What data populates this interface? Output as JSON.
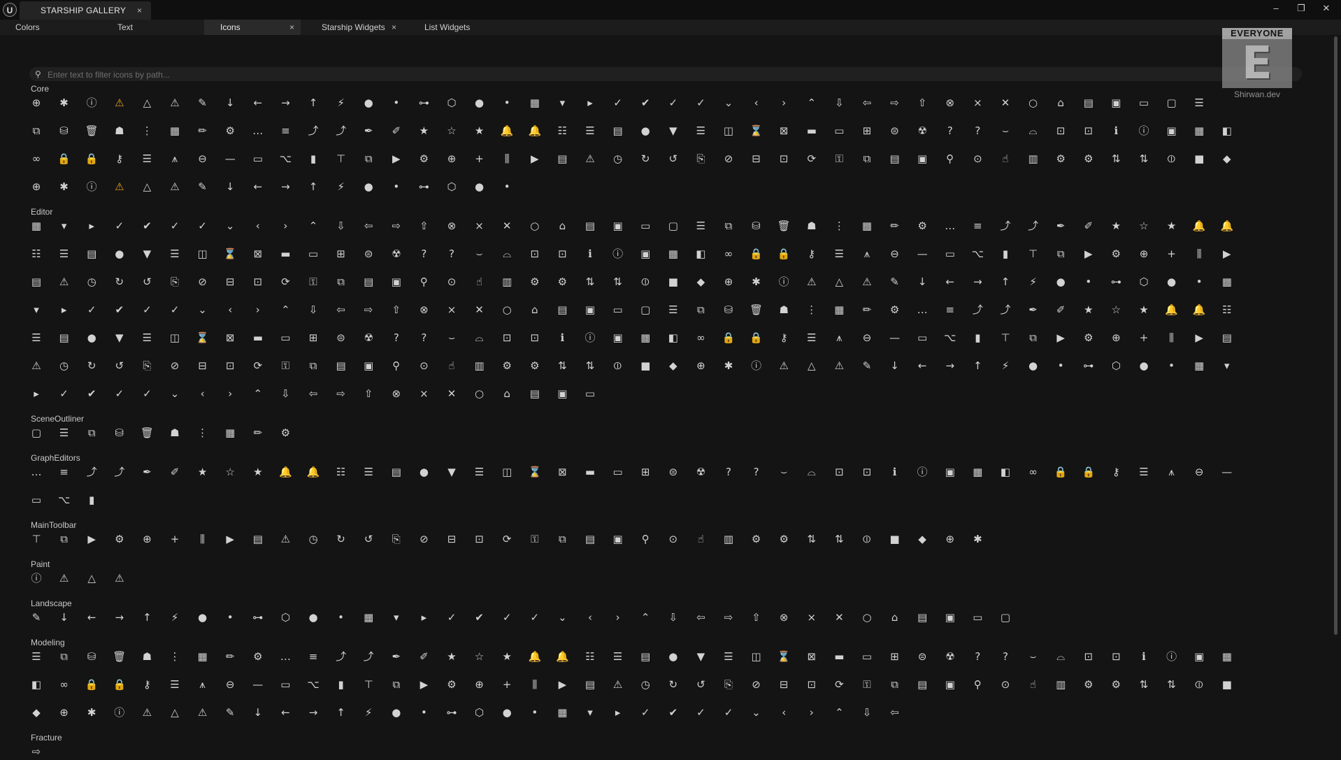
{
  "titlebar": {
    "tab_label": "STARSHIP GALLERY",
    "close_glyph": "×",
    "logo": "U",
    "window_buttons": [
      "–",
      "❐",
      "✕"
    ]
  },
  "tabs": [
    {
      "label": "Colors",
      "closable": false
    },
    {
      "label": "Text",
      "closable": false
    },
    {
      "label": "Icons",
      "closable": true
    },
    {
      "label": "Starship Widgets",
      "closable": true
    },
    {
      "label": "List Widgets",
      "closable": false
    }
  ],
  "search": {
    "placeholder": "Enter text to filter icons by path...",
    "value": ""
  },
  "badge": {
    "rating": "EVERYONE",
    "letter": "E",
    "site": "Shirwan.dev"
  },
  "sections": [
    {
      "name": "Core",
      "rows": [
        43,
        44,
        44,
        18
      ]
    },
    {
      "name": "Editor",
      "rows": [
        44,
        44,
        44,
        44,
        44,
        44,
        21
      ]
    },
    {
      "name": "SceneOutliner",
      "rows": [
        10
      ]
    },
    {
      "name": "GraphEditors",
      "rows": [
        44,
        3
      ]
    },
    {
      "name": "MainToolbar",
      "rows": [
        35
      ]
    },
    {
      "name": "Paint",
      "rows": [
        4
      ]
    },
    {
      "name": "Landscape",
      "rows": [
        36
      ]
    },
    {
      "name": "Modeling",
      "rows": [
        44,
        44,
        32
      ]
    },
    {
      "name": "Fracture",
      "rows": [
        1
      ]
    }
  ],
  "icon_glyphs": [
    "⊕",
    "✱",
    "ⓘ",
    "⚠",
    "△",
    "⚠",
    "✎",
    "↓",
    "←",
    "→",
    "↑",
    "⚡",
    "●",
    "•",
    "⊶",
    "⬡",
    "●",
    "•",
    "▦",
    "▾",
    "▸",
    "✓",
    "✔",
    "✓",
    "✓",
    "⌄",
    "‹",
    "›",
    "⌃",
    "⇩",
    "⇦",
    "⇨",
    "⇧",
    "⊗",
    "×",
    "✕",
    "○",
    "⌂",
    "▤",
    "▣",
    "▭",
    "▢",
    "☰",
    "⧉",
    "⛁",
    "🗑",
    "☗",
    "⋮",
    "▦",
    "✏",
    "⚙",
    "…",
    "≡",
    "⤴",
    "⤴",
    "✒",
    "✐",
    "★",
    "☆",
    "★",
    "🔔",
    "🔔",
    "☷",
    "☰",
    "▤",
    "●",
    "▼",
    "☰",
    "◫",
    "⌛",
    "⊠",
    "▬",
    "▭",
    "⊞",
    "⊜",
    "☢",
    "?",
    "?",
    "⌣",
    "⌓",
    "⊡",
    "⊡",
    "ℹ",
    "ⓘ",
    "▣",
    "▦",
    "◧",
    "∞",
    "🔒",
    "🔒",
    "⚷",
    "☰",
    "⩚",
    "⊖",
    "—",
    "▭",
    "⌥",
    "▮",
    "⊤",
    "⧉",
    "▶",
    "⚙",
    "⊕",
    "+",
    "⫼",
    "▶",
    "▤",
    "⚠",
    "◷",
    "↻",
    "↺",
    "⎘",
    "⊘",
    "⊟",
    "⊡",
    "⟳",
    "⚿",
    "⧉",
    "▤",
    "▣",
    "⚲",
    "⊙",
    "☝",
    "▥",
    "⚙",
    "⚙",
    "⇅",
    "⇅",
    "⦶",
    "■",
    "◆"
  ]
}
